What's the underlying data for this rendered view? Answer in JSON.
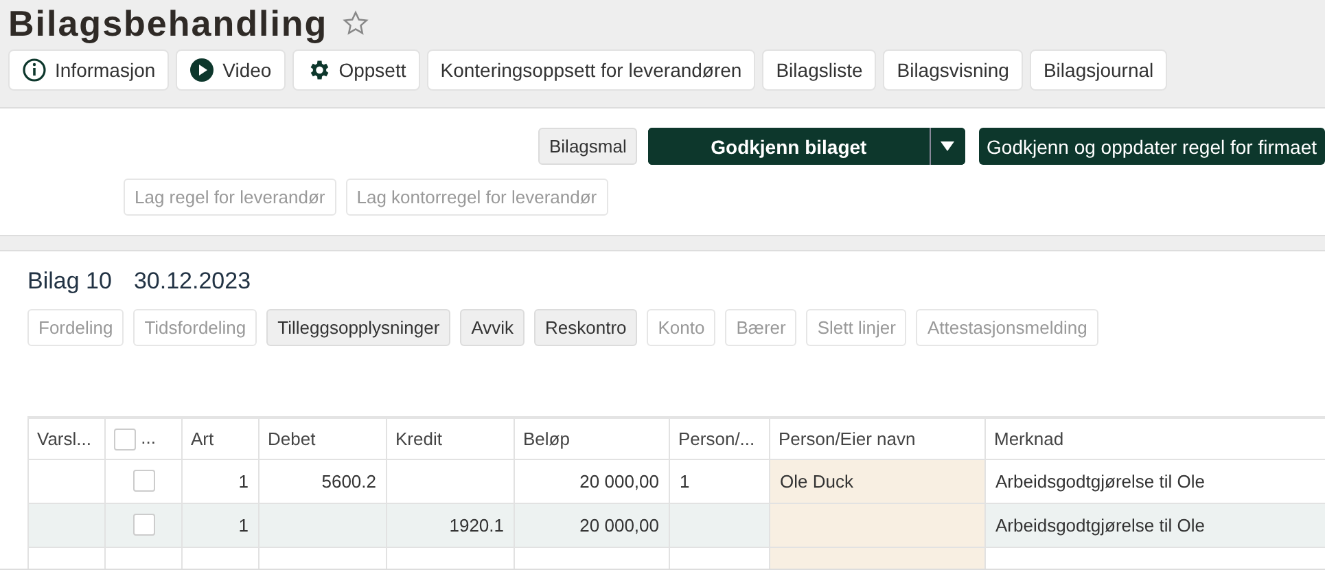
{
  "title": "Bilagsbehandling",
  "favorite": false,
  "nav_buttons": [
    {
      "label": "Informasjon",
      "kind": "info"
    },
    {
      "label": "Video",
      "kind": "video"
    },
    {
      "label": "Oppsett",
      "kind": "settings"
    },
    {
      "label": "Konteringsoppsett for leverandøren"
    },
    {
      "label": "Bilagsliste"
    },
    {
      "label": "Bilagsvisning"
    },
    {
      "label": "Bilagsjournal"
    }
  ],
  "actions": {
    "template_button": "Bilagsmal",
    "approve_button": "Godkjenn bilaget",
    "approve_update_button": "Godkjenn og oppdater regel for firmaet",
    "rule_buttons": [
      "Lag regel for leverandør",
      "Lag kontorregel for leverandør"
    ]
  },
  "voucher": {
    "number": "Bilag 10",
    "date": "30.12.2023"
  },
  "section_buttons": [
    {
      "label": "Fordeling",
      "disabled": true
    },
    {
      "label": "Tidsfordeling",
      "disabled": true
    },
    {
      "label": "Tilleggsopplysninger",
      "disabled": false
    },
    {
      "label": "Avvik",
      "disabled": false
    },
    {
      "label": "Reskontro",
      "disabled": false
    },
    {
      "label": "Konto",
      "disabled": true
    },
    {
      "label": "Bærer",
      "disabled": true
    },
    {
      "label": "Slett linjer",
      "disabled": true
    },
    {
      "label": "Attestasjonsmelding",
      "disabled": true
    }
  ],
  "table": {
    "columns": [
      "Varsl...",
      "...",
      "Art",
      "Debet",
      "Kredit",
      "Beløp",
      "Person/...",
      "Person/Eier navn",
      "Merknad"
    ],
    "header_checked": false,
    "rows": [
      {
        "selected": false,
        "checked": false,
        "art": "1",
        "debet": "5600.2",
        "belop": "20 000,00",
        "person": "1",
        "person_name": "Ole Duck",
        "merknad": "Arbeidsgodtgjørelse til Ole"
      },
      {
        "selected": true,
        "checked": false,
        "art": "1",
        "kredit": "1920.1",
        "belop": "20 000,00",
        "merknad": "Arbeidsgodtgjørelse til Ole"
      }
    ]
  }
}
